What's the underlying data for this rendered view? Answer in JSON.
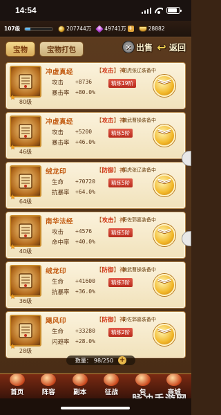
{
  "status": {
    "time": "14:54"
  },
  "resources": {
    "level": "107级",
    "exp_fraction": 0.2,
    "coins": "207744万",
    "gems": "49741万",
    "ingots": "28882"
  },
  "header": {
    "tabs": [
      {
        "label": "宝物"
      },
      {
        "label": "宝物打包"
      }
    ],
    "sell_label": "出售",
    "back_label": "返回"
  },
  "items": [
    {
      "name": "冲虚真经",
      "type_prefix": "【",
      "type": "攻击",
      "type_suffix": "】神",
      "equipped": "昭虎张辽装备中",
      "stats": [
        {
          "k": "攻击",
          "v": "+8736"
        },
        {
          "k": "暴击率",
          "v": "+80.0%"
        }
      ],
      "refine": "精炼19阶",
      "level": "80级"
    },
    {
      "name": "冲虚真经",
      "type_prefix": "【",
      "type": "攻击",
      "type_suffix": "】神",
      "equipped": "魏武曹操装备中",
      "stats": [
        {
          "k": "攻击",
          "v": "+5200"
        },
        {
          "k": "暴击率",
          "v": "+46.0%"
        }
      ],
      "refine": "精炼5阶",
      "level": "46级"
    },
    {
      "name": "绒龙印",
      "type_prefix": "【",
      "type": "防御",
      "type_suffix": "】神",
      "equipped": "昭虎张辽装备中",
      "stats": [
        {
          "k": "生命",
          "v": "+70720"
        },
        {
          "k": "抗暴率",
          "v": "+64.0%"
        }
      ],
      "refine": "精炼5阶",
      "level": "64级"
    },
    {
      "name": "南华法经",
      "type_prefix": "【",
      "type": "攻击",
      "type_suffix": "】神",
      "equipped": "奇佐郭嘉装备中",
      "stats": [
        {
          "k": "攻击",
          "v": "+4576"
        },
        {
          "k": "命中率",
          "v": "+40.0%"
        }
      ],
      "refine": "精炼5阶",
      "level": "40级"
    },
    {
      "name": "绒龙印",
      "type_prefix": "【",
      "type": "防御",
      "type_suffix": "】神",
      "equipped": "魏武曹操装备中",
      "stats": [
        {
          "k": "生命",
          "v": "+41600"
        },
        {
          "k": "抗暴率",
          "v": "+36.0%"
        }
      ],
      "refine": "精炼3阶",
      "level": "36级"
    },
    {
      "name": "飓风印",
      "type_prefix": "【",
      "type": "防御",
      "type_suffix": "】神",
      "equipped": "奇佐郭嘉装备中",
      "stats": [
        {
          "k": "生命",
          "v": "+33280"
        },
        {
          "k": "闪避率",
          "v": "+28.0%"
        }
      ],
      "refine": "精炼2阶",
      "level": "28级"
    }
  ],
  "count": {
    "label": "数量：",
    "value": "98/250"
  },
  "nav": [
    {
      "label": "首页"
    },
    {
      "label": "阵容"
    },
    {
      "label": "副本"
    },
    {
      "label": "征战"
    },
    {
      "label": "包"
    },
    {
      "label": "商城"
    }
  ],
  "watermark": "脉冲手游网",
  "colors": {
    "accent": "#f2b82a",
    "refine": "#c8301e",
    "attack": "#d23a1a"
  }
}
